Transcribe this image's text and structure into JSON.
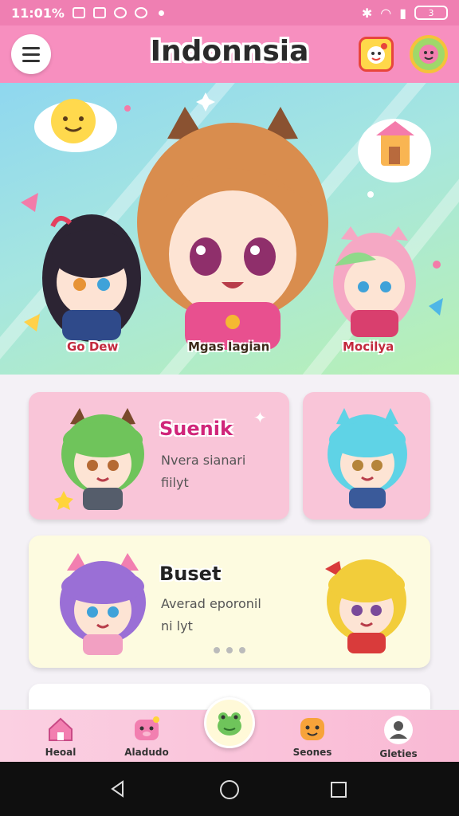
{
  "status_bar": {
    "time": "11:01%",
    "battery": "3"
  },
  "header": {
    "title": "Indonnsia"
  },
  "hero": {
    "characters": [
      {
        "label": "Go Dew"
      },
      {
        "label": "Mgas Iagian"
      },
      {
        "label": "Mocilya"
      }
    ]
  },
  "cards": [
    {
      "title": "Suenik",
      "subtitle": "Nvera sianari",
      "tag": "fiilyt"
    },
    {
      "title": "Buset",
      "subtitle": "Averad eporonil",
      "tag": "ni lyt"
    }
  ],
  "bottom_nav": {
    "items": [
      {
        "label": "Heoal"
      },
      {
        "label": "Aladudo"
      },
      {
        "label": "Seones"
      },
      {
        "label": "Gleties"
      }
    ]
  },
  "colors": {
    "status_bar": "#ef7fb2",
    "app_bar": "#f78fbf",
    "card_pink": "#f9c5d8",
    "card_cream": "#fdfbe0",
    "title_magenta": "#d0267a"
  }
}
